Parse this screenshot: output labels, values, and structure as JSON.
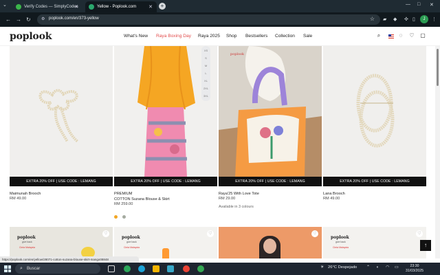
{
  "browser": {
    "tabs": [
      {
        "title": "Verify Codes — SimplyCodes",
        "favicon_color": "#3bb54a"
      },
      {
        "title": "Yellow - Poplook.com",
        "favicon_color": "#2aa86d"
      }
    ],
    "url": "poplook.com/en/373-yellow",
    "new_tab_symbol": "+",
    "profile_initial": "J"
  },
  "site": {
    "logo": "poplook",
    "menu": [
      "What's New",
      "Raya Boxing Day",
      "Raya 2025",
      "Shop",
      "Bestsellers",
      "Collection",
      "Sale"
    ],
    "active_menu_color": "#e24b4b"
  },
  "sizes": [
    "XS",
    "S",
    "M",
    "L",
    "XL",
    "2XL",
    "3XL",
    "4XL"
  ],
  "products": [
    {
      "name": "Maimunah Brooch",
      "price": "RM 49.00",
      "promo": "EXTRA 20% OFF | USE CODE : LEMANG"
    },
    {
      "name_top": "PREMIUM",
      "name": "COTTON Suzana Blouse & Skirt",
      "price": "RM 259.00",
      "promo": "EXTRA 20% OFF | USE CODE : LEMANG",
      "swatches": [
        "#f2a624",
        "#a5aba0"
      ]
    },
    {
      "name": "Raya'25 With Love Tote",
      "price": "RM 29.00",
      "availability": "Available in 3 colours",
      "promo": "EXTRA 20% OFF | USE CODE : LEMANG"
    },
    {
      "name": "Lana Brooch",
      "price": "RM 49.00",
      "promo": "EXTRA 20% OFF | USE CODE : LEMANG"
    }
  ],
  "row2": {
    "logo": "poplook",
    "sub": "give back",
    "malaysia": "Cinta Malaysia"
  },
  "status_url": "https://poplook.com/en/yellow/28071-cotton-suzana-blouse-skirt-mango08848",
  "taskbar": {
    "search": "Buscar",
    "weather": "26°C  Despejado",
    "time": "23:30",
    "date": "31/03/2025"
  }
}
